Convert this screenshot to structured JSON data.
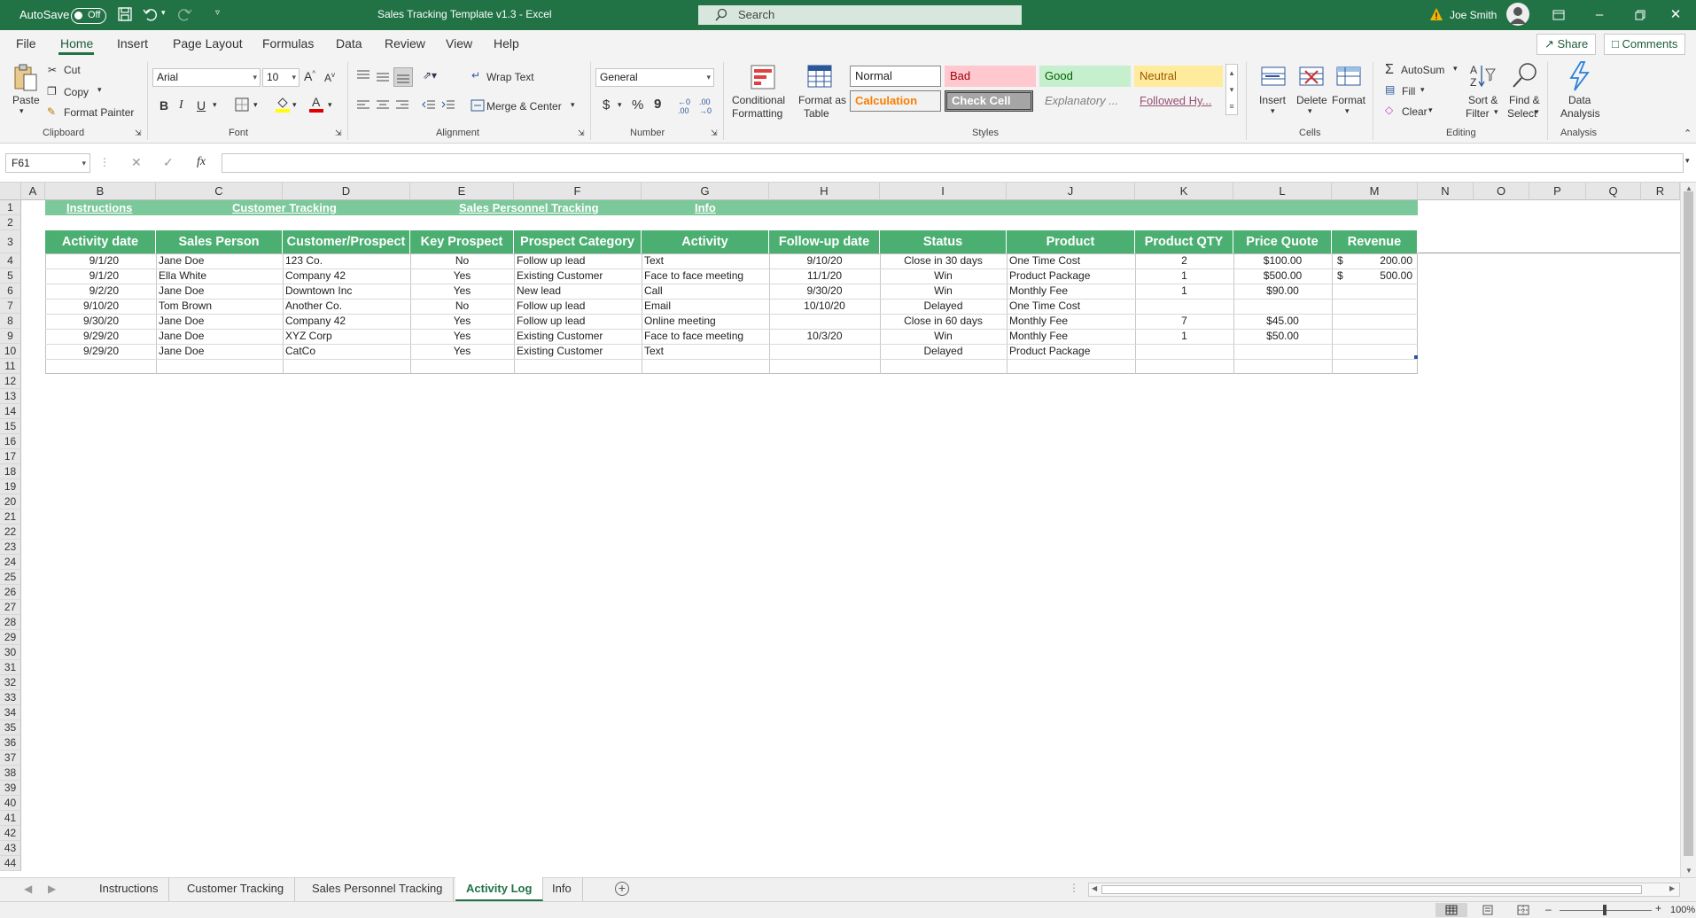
{
  "titlebar": {
    "autosave_label": "AutoSave",
    "autosave_state": "Off",
    "doc_title": "Sales Tracking Template v1.3  -  Excel",
    "search_placeholder": "Search",
    "user_name": "Joe Smith"
  },
  "menu": {
    "tabs": [
      "File",
      "Home",
      "Insert",
      "Page Layout",
      "Formulas",
      "Data",
      "Review",
      "View",
      "Help"
    ],
    "active_tab": "Home",
    "share_label": "Share",
    "comments_label": "Comments"
  },
  "ribbon": {
    "clipboard": {
      "paste": "Paste",
      "cut": "Cut",
      "copy": "Copy",
      "format_painter": "Format Painter",
      "group": "Clipboard"
    },
    "font": {
      "name": "Arial",
      "size": "10",
      "group": "Font",
      "bold": "B",
      "italic": "I",
      "underline": "U"
    },
    "alignment": {
      "wrap_text": "Wrap Text",
      "merge_center": "Merge & Center",
      "group": "Alignment"
    },
    "number": {
      "format": "General",
      "group": "Number",
      "currency": "$",
      "percent": "%",
      "comma": "9"
    },
    "styles": {
      "conditional_1": "Conditional",
      "conditional_2": "Formatting",
      "format_table_1": "Format as",
      "format_table_2": "Table",
      "group": "Styles",
      "normal": "Normal",
      "bad": "Bad",
      "good": "Good",
      "neutral": "Neutral",
      "calculation": "Calculation",
      "check_cell": "Check Cell",
      "explanatory": "Explanatory ...",
      "followed": "Followed Hy..."
    },
    "cells": {
      "insert": "Insert",
      "delete": "Delete",
      "format": "Format",
      "group": "Cells"
    },
    "editing": {
      "autosum": "AutoSum",
      "fill": "Fill",
      "clear": "Clear",
      "sort_1": "Sort &",
      "sort_2": "Filter",
      "find_1": "Find &",
      "find_2": "Select",
      "group": "Editing"
    },
    "analysis": {
      "data_1": "Data",
      "data_2": "Analysis",
      "group": "Analysis"
    }
  },
  "formula_bar": {
    "name_box": "F61",
    "fx": "fx",
    "value": ""
  },
  "grid": {
    "columns": [
      "A",
      "B",
      "C",
      "D",
      "E",
      "F",
      "G",
      "H",
      "I",
      "J",
      "K",
      "L",
      "M",
      "N",
      "O",
      "P",
      "Q",
      "R"
    ],
    "nav_links": [
      "Instructions",
      "Customer Tracking",
      "Sales Personnel Tracking",
      "Info"
    ],
    "headers": [
      "Activity date",
      "Sales Person",
      "Customer/Prospect",
      "Key Prospect",
      "Prospect Category",
      "Activity",
      "Follow-up date",
      "Status",
      "Product",
      "Product QTY",
      "Price Quote",
      "Revenue"
    ],
    "rows": [
      [
        "9/1/20",
        "Jane Doe",
        "123 Co.",
        "No",
        "Follow up lead",
        "Text",
        "9/10/20",
        "Close in 30 days",
        "One Time Cost",
        "2",
        "$100.00",
        "$",
        "200.00"
      ],
      [
        "9/1/20",
        "Ella White",
        "Company 42",
        "Yes",
        "Existing Customer",
        "Face to face meeting",
        "11/1/20",
        "Win",
        "Product Package",
        "1",
        "$500.00",
        "$",
        "500.00"
      ],
      [
        "9/2/20",
        "Jane Doe",
        "Downtown Inc",
        "Yes",
        "New lead",
        "Call",
        "9/30/20",
        "Win",
        "Monthly Fee",
        "1",
        "$90.00",
        "",
        ""
      ],
      [
        "9/10/20",
        "Tom Brown",
        "Another Co.",
        "No",
        "Follow up lead",
        "Email",
        "10/10/20",
        "Delayed",
        "One Time Cost",
        "",
        "",
        "",
        ""
      ],
      [
        "9/30/20",
        "Jane Doe",
        "Company 42",
        "Yes",
        "Follow up lead",
        "Online meeting",
        "",
        "Close in 60 days",
        "Monthly Fee",
        "7",
        "$45.00",
        "",
        ""
      ],
      [
        "9/29/20",
        "Jane Doe",
        "XYZ Corp",
        "Yes",
        "Existing Customer",
        "Face to face meeting",
        "10/3/20",
        "Win",
        "Monthly Fee",
        "1",
        "$50.00",
        "",
        ""
      ],
      [
        "9/29/20",
        "Jane Doe",
        "CatCo",
        "Yes",
        "Existing Customer",
        "Text",
        "",
        "Delayed",
        "Product Package",
        "",
        "",
        "",
        ""
      ]
    ],
    "row_numbers": [
      "1",
      "2",
      "3",
      "4",
      "5",
      "6",
      "7",
      "8",
      "9",
      "10",
      "11",
      "12",
      "13",
      "14",
      "15",
      "16",
      "17",
      "18",
      "19",
      "20",
      "21",
      "22",
      "23",
      "24",
      "25",
      "26",
      "27",
      "28",
      "29",
      "30",
      "31",
      "32",
      "33",
      "34",
      "35",
      "36",
      "37",
      "38",
      "39",
      "40",
      "41",
      "42",
      "43",
      "44"
    ]
  },
  "sheet_tabs": [
    "Instructions",
    "Customer Tracking",
    "Sales Personnel Tracking",
    "Activity Log",
    "Info"
  ],
  "active_sheet": "Activity Log",
  "status": {
    "zoom": "100%"
  },
  "colors": {
    "excel_green": "#217346",
    "header_green": "#4caf72",
    "band_green": "#7bc89a"
  }
}
